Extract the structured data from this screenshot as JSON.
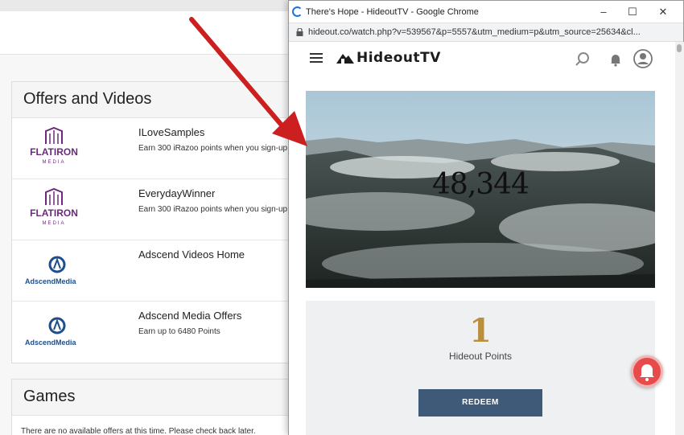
{
  "background_page": {
    "offers_panel": {
      "title": "Offers and Videos",
      "offers": [
        {
          "logo": "flatiron-media-logo",
          "logo_text": "FLATIRON",
          "logo_sub": "MEDIA",
          "title": "ILoveSamples",
          "description": "Earn 300 iRazoo points when you sign-up"
        },
        {
          "logo": "flatiron-media-logo",
          "logo_text": "FLATIRON",
          "logo_sub": "MEDIA",
          "title": "EverydayWinner",
          "description": "Earn 300 iRazoo points when you sign-up"
        },
        {
          "logo": "adscend-media-logo",
          "logo_text": "AdscendMedia",
          "title": "Adscend Videos Home",
          "description": ""
        },
        {
          "logo": "adscend-media-logo",
          "logo_text": "AdscendMedia",
          "title": "Adscend Media Offers",
          "description": "Earn up to 6480 Points"
        }
      ]
    },
    "games_panel": {
      "title": "Games",
      "empty_message": "There are no available offers at this time. Please check back later."
    }
  },
  "popup_window": {
    "title": "There's Hope - HideoutTV - Google Chrome",
    "url": "hideout.co/watch.php?v=539567&p=5557&utm_medium=p&utm_source=25634&cl...",
    "controls": {
      "minimize": "–",
      "maximize": "☐",
      "close": "✕"
    },
    "site": {
      "brand": "HideoutTV",
      "video_counter": "48,344",
      "points_value": "1",
      "points_label": "Hideout Points",
      "redeem_label": "REDEEM"
    }
  },
  "colors": {
    "accent_gold": "#b98e3f",
    "redeem_button": "#3e5a78",
    "annotation_arrow": "#cc1f1f",
    "notification_fab": "#e84b4b"
  }
}
